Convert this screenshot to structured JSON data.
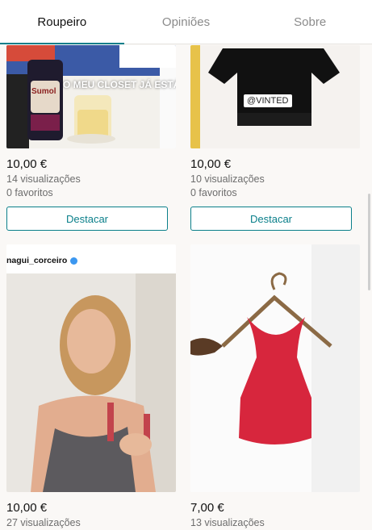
{
  "tabs": [
    {
      "label": "Roupeiro",
      "active": true
    },
    {
      "label": "Opiniões",
      "active": false
    },
    {
      "label": "Sobre",
      "active": false
    }
  ],
  "items": [
    {
      "price": "10,00 €",
      "views": "14 visualizações",
      "favorites": "0 favoritos",
      "button": "Destacar",
      "overlay_text": "O MEU CLOSET JÁ ESTÁ DISPONÍVEL!!",
      "can_label": "Sumol"
    },
    {
      "price": "10,00 €",
      "views": "10 visualizações",
      "favorites": "0 favoritos",
      "button": "Destacar",
      "overlay_tag": "@VINTED"
    },
    {
      "price": "10,00 €",
      "views": "27 visualizações",
      "username": "nagui_corceiro"
    },
    {
      "price": "7,00 €",
      "views": "13 visualizações"
    }
  ],
  "colors": {
    "accent": "#0a7f8a",
    "background": "#faf8f6",
    "top_red": "#d7263d"
  }
}
